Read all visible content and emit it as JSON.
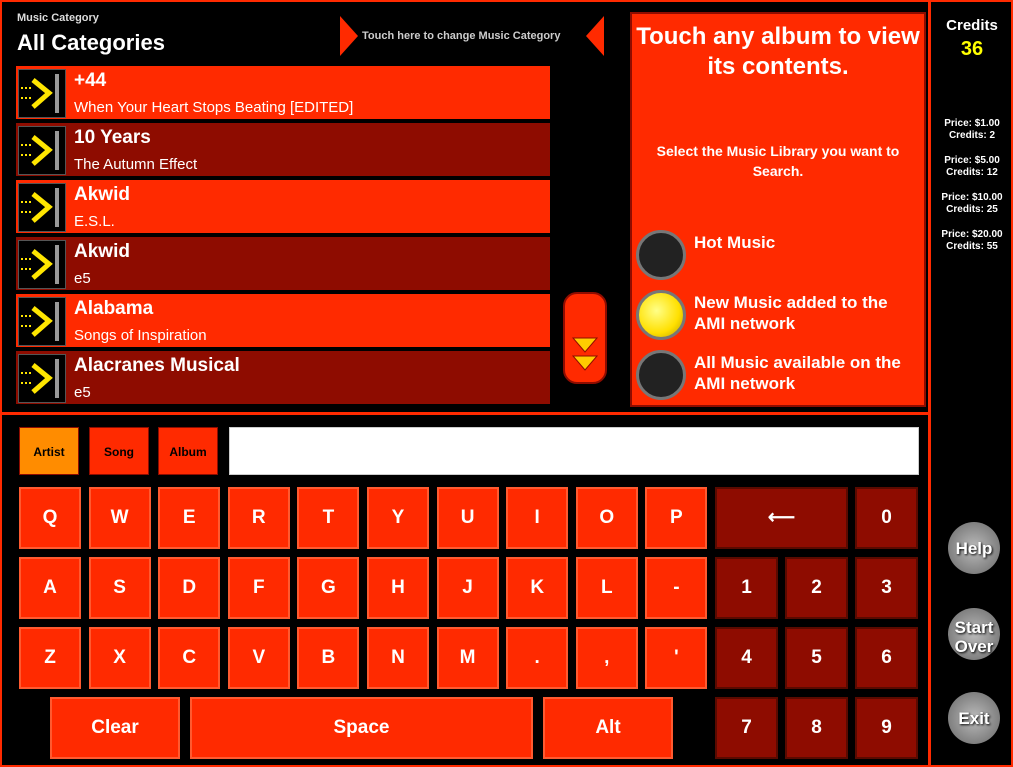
{
  "header": {
    "category_label": "Music Category",
    "category_value": "All Categories",
    "change_hint": "Touch here to change Music Category"
  },
  "albums": [
    {
      "artist": "+44",
      "album": "When Your Heart Stops Beating [EDITED]"
    },
    {
      "artist": "10 Years",
      "album": "The Autumn Effect"
    },
    {
      "artist": "Akwid",
      "album": "E.S.L."
    },
    {
      "artist": "Akwid",
      "album": "e5"
    },
    {
      "artist": "Alabama",
      "album": "Songs of Inspiration"
    },
    {
      "artist": "Alacranes Musical",
      "album": "e5"
    }
  ],
  "info": {
    "title": "Touch any album to view its contents.",
    "subtitle": "Select the Music Library you want to Search.",
    "libraries": [
      {
        "label": "Hot Music",
        "selected": false
      },
      {
        "label": "New Music added to the AMI network",
        "selected": true
      },
      {
        "label": "All Music available on the AMI network",
        "selected": false
      }
    ]
  },
  "sidebar": {
    "credits_label": "Credits",
    "credits_value": "36",
    "prices": [
      {
        "price": "Price: $1.00",
        "credits": "Credits: 2"
      },
      {
        "price": "Price: $5.00",
        "credits": "Credits: 12"
      },
      {
        "price": "Price: $10.00",
        "credits": "Credits: 25"
      },
      {
        "price": "Price: $20.00",
        "credits": "Credits: 55"
      }
    ],
    "help": "Help",
    "start_over": "Start Over",
    "exit": "Exit"
  },
  "search": {
    "tabs": [
      "Artist",
      "Song",
      "Album"
    ],
    "active_tab": "Artist",
    "value": ""
  },
  "keyboard": {
    "row1": [
      "Q",
      "W",
      "E",
      "R",
      "T",
      "Y",
      "U",
      "I",
      "O",
      "P"
    ],
    "row2": [
      "A",
      "S",
      "D",
      "F",
      "G",
      "H",
      "J",
      "K",
      "L",
      "-"
    ],
    "row3": [
      "Z",
      "X",
      "C",
      "V",
      "B",
      "N",
      "M",
      ".",
      ",",
      "'"
    ],
    "backspace": "⟵",
    "numbers": [
      "0",
      "1",
      "2",
      "3",
      "4",
      "5",
      "6",
      "7",
      "8",
      "9"
    ],
    "clear": "Clear",
    "space": "Space",
    "alt": "Alt"
  },
  "colors": {
    "primary": "#ff2a00",
    "dark": "#8e0c00",
    "accent": "#ffff00",
    "tab_active": "#ff8c00"
  }
}
